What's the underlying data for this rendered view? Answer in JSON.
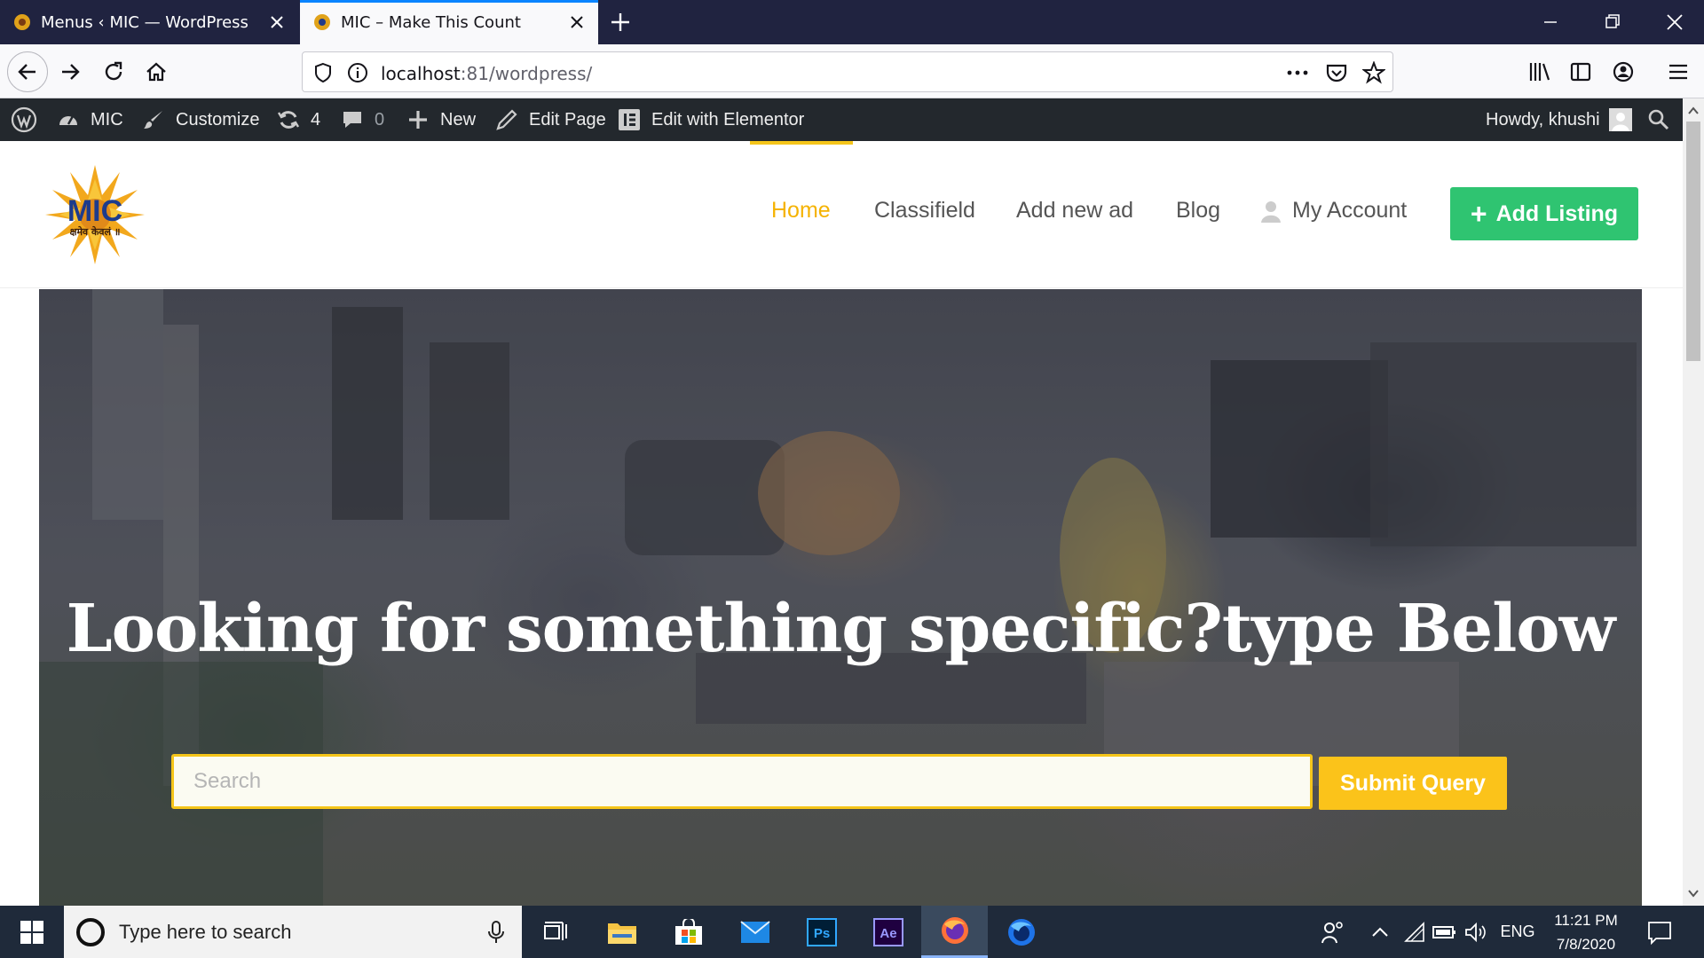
{
  "browser": {
    "tabs": [
      {
        "title": "Menus ‹ MIC — WordPress",
        "active": false
      },
      {
        "title": "MIC – Make This Count",
        "active": true
      }
    ],
    "url": {
      "host": "localhost",
      "rest": ":81/wordpress/"
    }
  },
  "adminbar": {
    "site": "MIC",
    "customize": "Customize",
    "updates": "4",
    "comments": "0",
    "new": "New",
    "edit_page": "Edit Page",
    "edit_elementor": "Edit with Elementor",
    "howdy": "Howdy, khushi"
  },
  "site": {
    "logo_text": "MIC",
    "logo_subtitle": "क्षमेव केवलं ॥",
    "nav": [
      "Home",
      "Classifield",
      "Add new ad",
      "Blog",
      "My Account"
    ],
    "active_nav": "Home",
    "add_listing": "Add Listing"
  },
  "hero": {
    "title": "Looking for something specific?type Below",
    "search_placeholder": "Search",
    "submit": "Submit Query"
  },
  "taskbar": {
    "search_placeholder": "Type here to search",
    "apps": [
      "task-view",
      "file-explorer",
      "microsoft-store",
      "mail",
      "photoshop",
      "after-effects",
      "firefox",
      "firefox-developer"
    ],
    "ps_label": "Ps",
    "ae_label": "Ae",
    "lang": "ENG",
    "time": "11:21 PM",
    "date": "7/8/2020"
  },
  "colors": {
    "accent_yellow": "#f5c51a",
    "add_listing_green": "#2fc471",
    "adminbar_bg": "#23282d",
    "tabstrip_bg": "#202340"
  }
}
